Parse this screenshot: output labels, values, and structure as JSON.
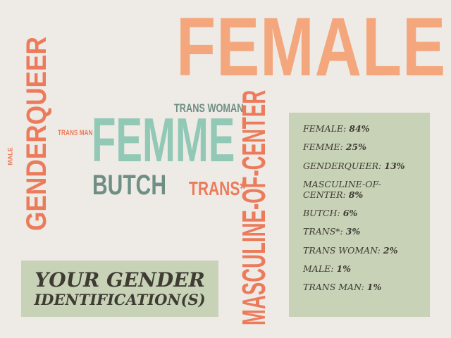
{
  "word_cloud": {
    "female": "FEMALE",
    "femme": "FEMME",
    "butch": "BUTCH",
    "trans_woman": "TRANS WOMAN",
    "trans_man": "TRANS MAN",
    "trans": "TRANS*",
    "genderqueer": "GENDERQUEER",
    "male": "MALE",
    "masculine_of_center": "MASCULINE-OF-CENTER"
  },
  "title": {
    "line1": "YOUR GENDER",
    "line2": "IDENTIFICATION(S)"
  },
  "stats": [
    {
      "label": "FEMALE:",
      "value": "84%"
    },
    {
      "label": "FEMME:",
      "value": "25%"
    },
    {
      "label": "GENDERQUEER:",
      "value": "13%"
    },
    {
      "label": "MASCULINE-OF-CENTER:",
      "value": "8%"
    },
    {
      "label": "BUTCH:",
      "value": "6%"
    },
    {
      "label": "TRANS*:",
      "value": "3%"
    },
    {
      "label": "TRANS WOMAN:",
      "value": "2%"
    },
    {
      "label": "MALE:",
      "value": "1%"
    },
    {
      "label": "TRANS MAN:",
      "value": "1%"
    }
  ],
  "colors": {
    "background": "#eeebe6",
    "peach": "#f4a77d",
    "coral": "#ec7b5b",
    "mint": "#92c9b6",
    "sage_dark": "#6f8f85",
    "panel": "#c7d2b7",
    "text_dark": "#3e3b33"
  }
}
